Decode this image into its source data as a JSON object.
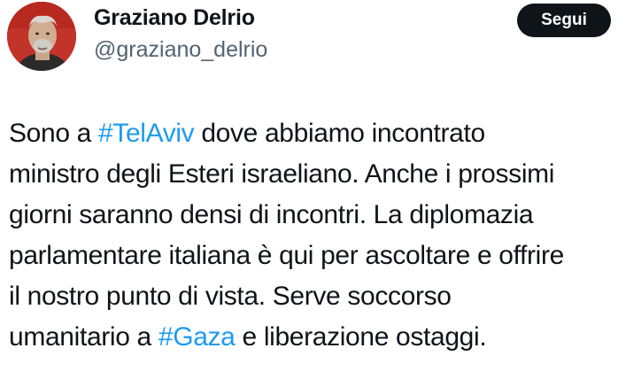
{
  "author": {
    "display_name": "Graziano Delrio",
    "handle": "@graziano_delrio"
  },
  "follow_button": {
    "label": "Segui"
  },
  "tweet": {
    "lines": [
      [
        {
          "text": "Sono a ",
          "hashtag": false
        },
        {
          "text": "#TelAviv",
          "hashtag": true
        },
        {
          "text": " dove abbiamo incontrato",
          "hashtag": false
        }
      ],
      [
        {
          "text": "ministro degli Esteri israeliano. Anche i prossimi",
          "hashtag": false
        }
      ],
      [
        {
          "text": "giorni saranno densi di incontri. La diplomazia",
          "hashtag": false
        }
      ],
      [
        {
          "text": "parlamentare italiana è qui per ascoltare e offrire",
          "hashtag": false
        }
      ],
      [
        {
          "text": "il nostro punto di vista. Serve soccorso",
          "hashtag": false
        }
      ],
      [
        {
          "text": "umanitario a ",
          "hashtag": false
        },
        {
          "text": "#Gaza",
          "hashtag": true
        },
        {
          "text": " e liberazione ostaggi.",
          "hashtag": false
        }
      ]
    ]
  },
  "colors": {
    "text": "#0f1419",
    "secondary_text": "#536471",
    "hashtag": "#1d9bf0",
    "follow_button_bg": "#0f1419",
    "avatar_bg": "#c2332a"
  }
}
